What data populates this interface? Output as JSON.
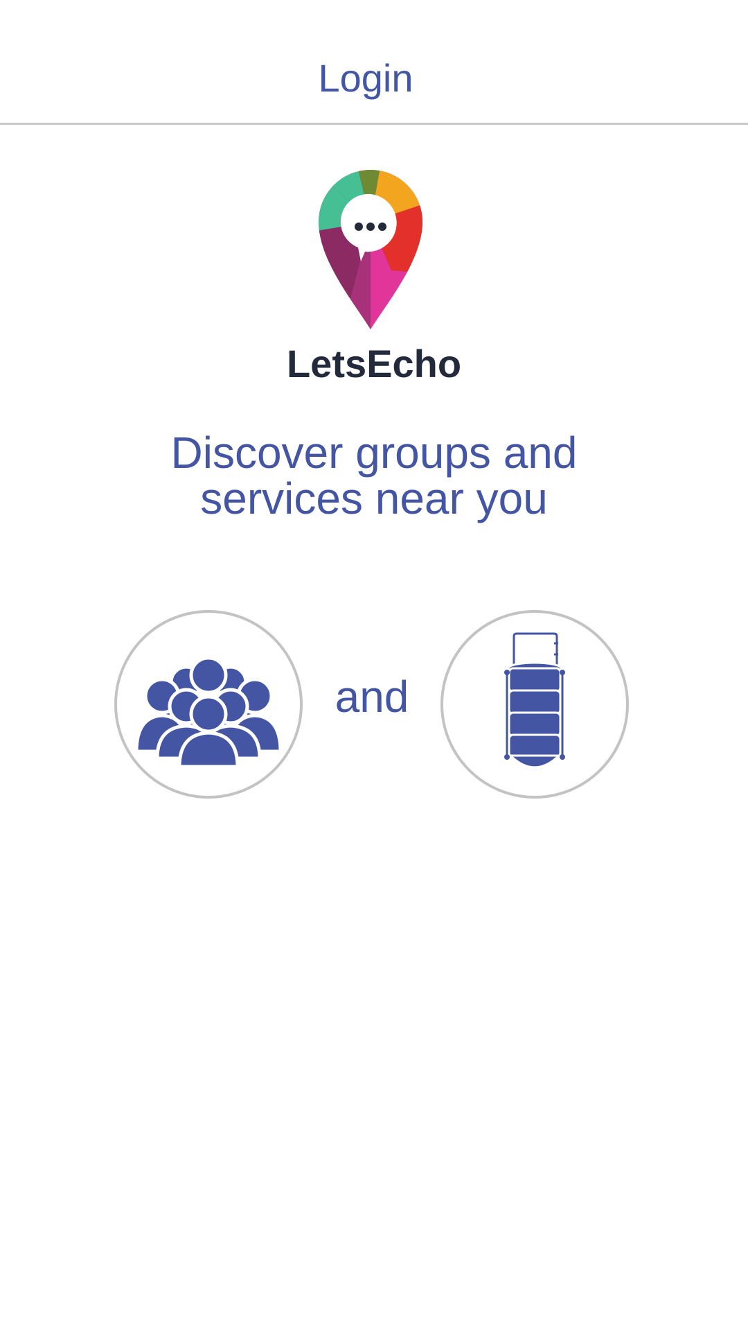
{
  "header": {
    "title": "Login"
  },
  "brand": {
    "name": "LetsEcho",
    "logo_icon": "letsecho-pin-logo-icon"
  },
  "tagline": {
    "line1": "Discover groups and",
    "line2": "services near you"
  },
  "features": {
    "groups_icon": "people-group-icon",
    "connector": "and",
    "services_icon": "tiffin-box-icon"
  },
  "colors": {
    "primary": "#4355a3",
    "brand_text": "#232a3b",
    "divider": "#c8c8c8",
    "circle_border": "#c3c3c3",
    "background": "#ffffff"
  }
}
